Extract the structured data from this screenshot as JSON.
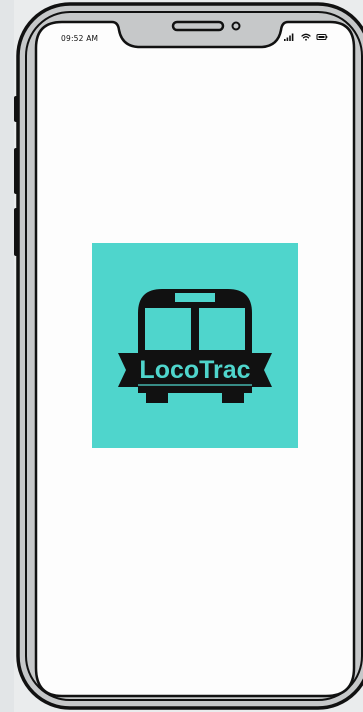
{
  "status_bar": {
    "time": "09:52 AM",
    "signal_icon": "signal-bars-icon",
    "wifi_icon": "wifi-icon",
    "battery_icon": "battery-icon"
  },
  "splash": {
    "brand_name": "LocoTrac",
    "logo_icon": "bus-icon",
    "colors": {
      "tile_background": "#4fd5cc",
      "ink": "#111111",
      "screen_background": "#fdfdfd",
      "frame": "#c6c8c9"
    }
  }
}
